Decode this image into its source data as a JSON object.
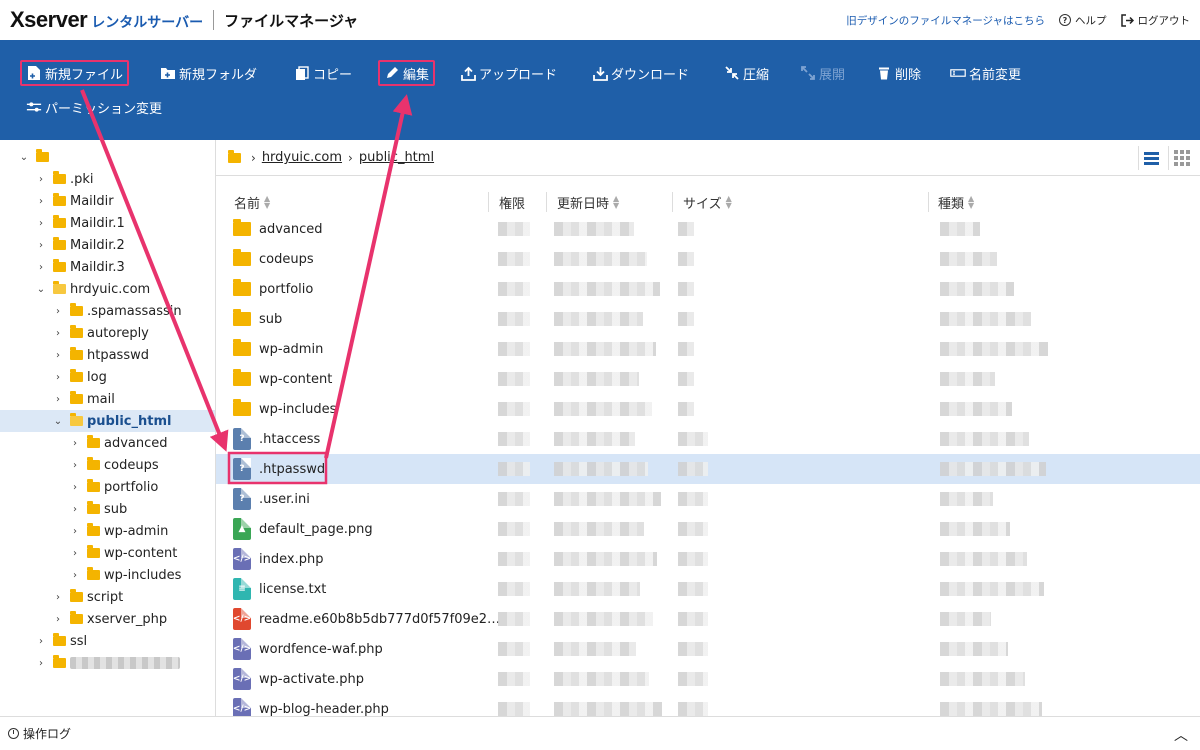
{
  "header": {
    "brand": "Xserver",
    "brand_sub": "レンタルサーバー",
    "app_title": "ファイルマネージャ",
    "old_design_link": "旧デザインのファイルマネージャはこちら",
    "help": "ヘルプ",
    "logout": "ログアウト"
  },
  "toolbar": {
    "new_file": "新規ファイル",
    "new_folder": "新規フォルダ",
    "copy": "コピー",
    "edit": "編集",
    "upload": "アップロード",
    "download": "ダウンロード",
    "compress": "圧縮",
    "extract": "展開",
    "delete": "削除",
    "rename": "名前変更",
    "permissions": "パーミッション変更"
  },
  "tree": [
    {
      "label": "",
      "level": 0,
      "state": "open"
    },
    {
      "label": ".pki",
      "level": 1,
      "state": "closed"
    },
    {
      "label": "Maildir",
      "level": 1,
      "state": "closed"
    },
    {
      "label": "Maildir.1",
      "level": 1,
      "state": "closed"
    },
    {
      "label": "Maildir.2",
      "level": 1,
      "state": "closed"
    },
    {
      "label": "Maildir.3",
      "level": 1,
      "state": "closed"
    },
    {
      "label": "hrdyuic.com",
      "level": 1,
      "state": "open"
    },
    {
      "label": ".spamassassin",
      "level": 2,
      "state": "closed"
    },
    {
      "label": "autoreply",
      "level": 2,
      "state": "closed"
    },
    {
      "label": "htpasswd",
      "level": 2,
      "state": "closed"
    },
    {
      "label": "log",
      "level": 2,
      "state": "closed"
    },
    {
      "label": "mail",
      "level": 2,
      "state": "closed"
    },
    {
      "label": "public_html",
      "level": 2,
      "state": "open",
      "selected": true
    },
    {
      "label": "advanced",
      "level": 3,
      "state": "closed"
    },
    {
      "label": "codeups",
      "level": 3,
      "state": "closed"
    },
    {
      "label": "portfolio",
      "level": 3,
      "state": "closed"
    },
    {
      "label": "sub",
      "level": 3,
      "state": "closed"
    },
    {
      "label": "wp-admin",
      "level": 3,
      "state": "closed"
    },
    {
      "label": "wp-content",
      "level": 3,
      "state": "closed"
    },
    {
      "label": "wp-includes",
      "level": 3,
      "state": "closed"
    },
    {
      "label": "script",
      "level": 2,
      "state": "closed"
    },
    {
      "label": "xserver_php",
      "level": 2,
      "state": "closed"
    },
    {
      "label": "ssl",
      "level": 1,
      "state": "closed"
    },
    {
      "label": "",
      "level": 1,
      "state": "closed",
      "blurred": true
    }
  ],
  "breadcrumb": [
    "hrdyuic.com",
    "public_html"
  ],
  "columns": {
    "name": "名前",
    "permission": "権限",
    "modified": "更新日時",
    "size": "サイズ",
    "type": "種類"
  },
  "files": [
    {
      "name": "advanced",
      "kind": "folder"
    },
    {
      "name": "codeups",
      "kind": "folder"
    },
    {
      "name": "portfolio",
      "kind": "folder"
    },
    {
      "name": "sub",
      "kind": "folder"
    },
    {
      "name": "wp-admin",
      "kind": "folder"
    },
    {
      "name": "wp-content",
      "kind": "folder"
    },
    {
      "name": "wp-includes",
      "kind": "folder"
    },
    {
      "name": ".htaccess",
      "kind": "unknown"
    },
    {
      "name": ".htpasswd",
      "kind": "unknown",
      "selected": true
    },
    {
      "name": ".user.ini",
      "kind": "unknown"
    },
    {
      "name": "default_page.png",
      "kind": "image"
    },
    {
      "name": "index.php",
      "kind": "php"
    },
    {
      "name": "license.txt",
      "kind": "text"
    },
    {
      "name": "readme.e60b8b5db777d0f57f09e2…",
      "kind": "html"
    },
    {
      "name": "wordfence-waf.php",
      "kind": "php"
    },
    {
      "name": "wp-activate.php",
      "kind": "php"
    },
    {
      "name": "wp-blog-header.php",
      "kind": "php"
    }
  ],
  "footer": {
    "log_label": "操作ログ"
  },
  "colors": {
    "toolbar_bg": "#1f5fa8",
    "highlight": "#e8336d",
    "selection": "#d6e5f7"
  }
}
